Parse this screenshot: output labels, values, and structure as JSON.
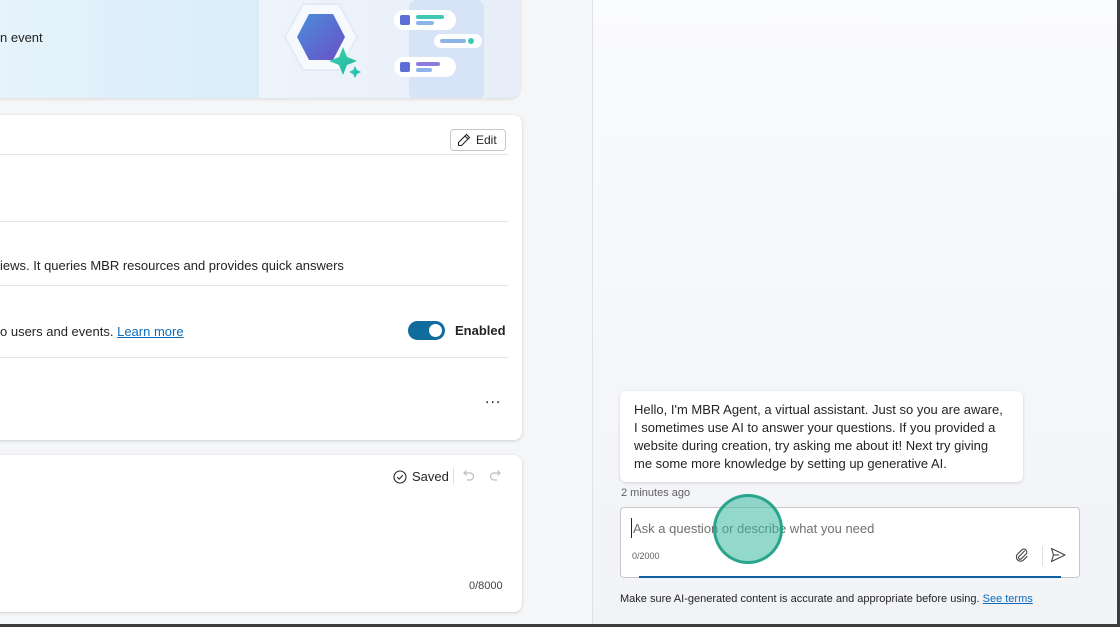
{
  "hero": {
    "text_fragment": "n event"
  },
  "details": {
    "edit_label": "Edit",
    "description_fragment": "iews. It queries MBR resources and provides quick answers",
    "orchestration_fragment": "o users and events.",
    "learn_more": "Learn more",
    "toggle_label": "Enabled",
    "toggle_on": true,
    "more_label": "..."
  },
  "instructions": {
    "saved_label": "Saved",
    "char_counter": "0/8000"
  },
  "chat": {
    "message": "Hello, I'm MBR Agent, a virtual assistant. Just so you are aware, I sometimes use AI to answer your questions. If you provided a website during creation, try asking me about it! Next try giving me some more knowledge by setting up generative AI.",
    "timestamp": "2 minutes ago",
    "input_placeholder": "Ask a question or describe what you need",
    "input_value": "",
    "char_count": "0/2000",
    "disclaimer": "Make sure AI-generated content is accurate and appropriate before using.",
    "see_terms": "See terms"
  },
  "colors": {
    "accent": "#0f6c9d",
    "link": "#0f6cbd",
    "click_marker": "#3ab9a0"
  },
  "icons": [
    "pencil-icon",
    "checkmark-circle-icon",
    "undo-icon",
    "redo-icon",
    "attach-icon",
    "send-icon",
    "agent-hexagon-icon"
  ]
}
